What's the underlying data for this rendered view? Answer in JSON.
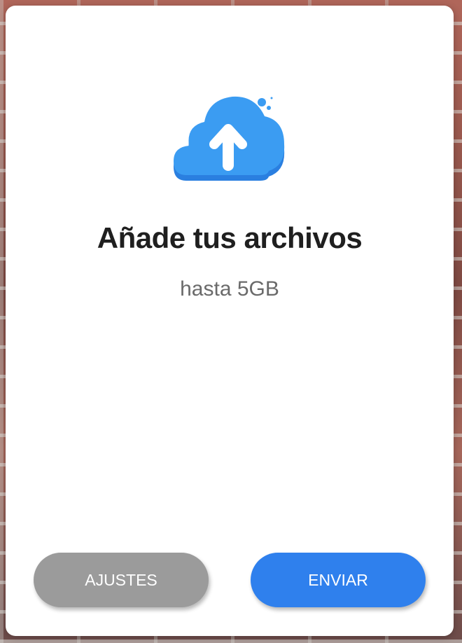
{
  "dialog": {
    "icon": "cloud-upload-icon",
    "title": "Añade tus archivos",
    "subtitle": "hasta 5GB",
    "settings_label": "AJUSTES",
    "send_label": "ENVIAR"
  },
  "colors": {
    "accent": "#2f80ed",
    "cloud": "#3b9cf2",
    "cloud_shadow": "#2a7fe0",
    "settings_button": "#9b9b9b",
    "title_text": "#1f1f1f",
    "subtitle_text": "#6a6a6a"
  }
}
